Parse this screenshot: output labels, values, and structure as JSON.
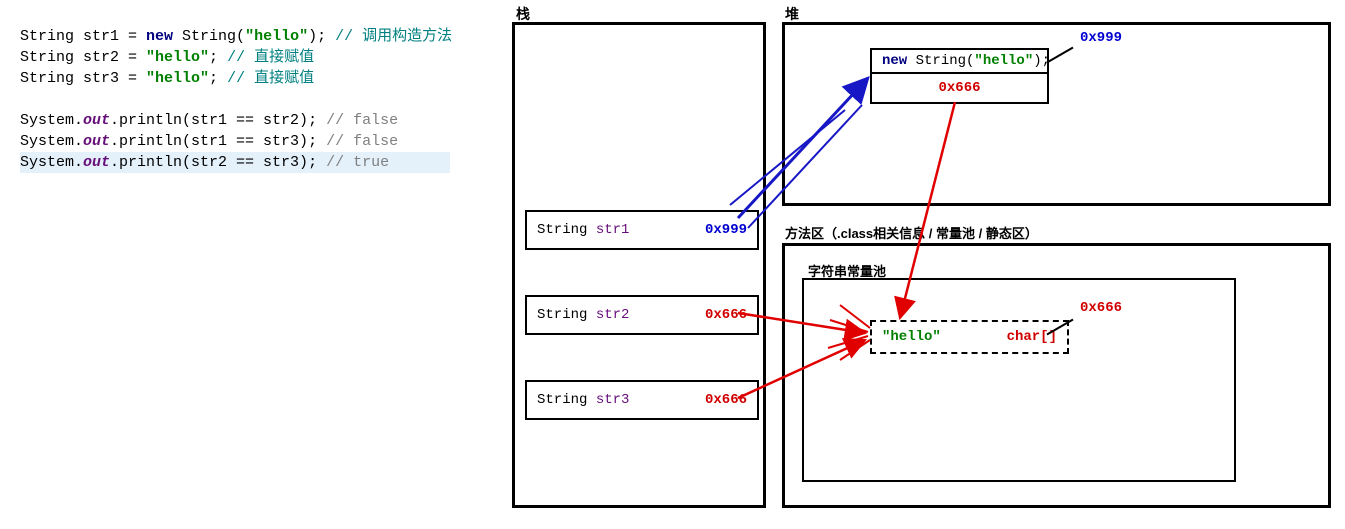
{
  "code": {
    "l1_a": "String str1 = ",
    "l1_new": "new ",
    "l1_b": "String(",
    "l1_str": "\"hello\"",
    "l1_c": "); ",
    "l1_cmt": "// 调用构造方法",
    "l2_a": "String str2 = ",
    "l2_str": "\"hello\"",
    "l2_b": "; ",
    "l2_cmt": "// 直接赋值",
    "l3_a": "String str3 = ",
    "l3_str": "\"hello\"",
    "l3_b": "; ",
    "l3_cmt": "// 直接赋值",
    "l4_a": "System.",
    "l4_out": "out",
    "l4_b": ".println(str1 == str2); ",
    "l4_cmt": "// false",
    "l5_a": "System.",
    "l5_out": "out",
    "l5_b": ".println(str1 == str3); ",
    "l5_cmt": "// false",
    "l6_a": "System.",
    "l6_out": "out",
    "l6_b": ".println(str2 == str3); ",
    "l6_cmt": "// true"
  },
  "labels": {
    "stack": "栈",
    "heap": "堆",
    "methodArea": "方法区（.class相关信息 / 常量池 / 静态区）",
    "stringPool": "字符串常量池"
  },
  "stack": {
    "row1": {
      "type": "String ",
      "name": "str1",
      "addr": "0x999"
    },
    "row2": {
      "type": "String ",
      "name": "str2",
      "addr": "0x666"
    },
    "row3": {
      "type": "String ",
      "name": "str3",
      "addr": "0x666"
    }
  },
  "heap": {
    "obj": {
      "new": "new ",
      "call": "String(",
      "arg": "\"hello\"",
      "end": ");",
      "addrSelf": "0x999",
      "field": "0x666"
    }
  },
  "pool": {
    "value": "\"hello\"",
    "type": "char[]",
    "addr": "0x666"
  }
}
